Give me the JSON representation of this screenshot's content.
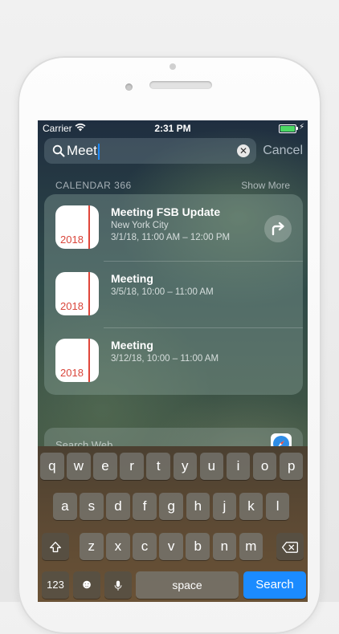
{
  "status_bar": {
    "carrier": "Carrier",
    "time": "2:31 PM",
    "battery_level": 1.0,
    "battery_color": "#4cd964",
    "charging_icon": "bolt-icon",
    "charging_glyph": "⚡"
  },
  "search": {
    "query": "Meet",
    "clear_glyph": "✕",
    "cancel_label": "Cancel"
  },
  "section": {
    "header": "CALENDAR 366",
    "show_more": "Show More"
  },
  "results": [
    {
      "title": "Meeting FSB Update",
      "location": "New York City",
      "datetime": "3/1/18, 11:00 AM – 12:00 PM",
      "icon_year": "2018"
    },
    {
      "title": "Meeting",
      "datetime": "3/5/18, 10:00 – 11:00 AM",
      "icon_year": "2018"
    },
    {
      "title": "Meeting",
      "datetime": "3/12/18, 10:00 – 11:00 AM",
      "icon_year": "2018"
    }
  ],
  "search_web": {
    "label": "Search Web"
  },
  "keyboard": {
    "row1": [
      "q",
      "w",
      "e",
      "r",
      "t",
      "y",
      "u",
      "i",
      "o",
      "p"
    ],
    "row2": [
      "a",
      "s",
      "d",
      "f",
      "g",
      "h",
      "j",
      "k",
      "l"
    ],
    "row3": [
      "z",
      "x",
      "c",
      "v",
      "b",
      "n",
      "m"
    ],
    "numbers_label": "123",
    "emoji_glyph": "☻",
    "space_label": "space",
    "search_label": "Search",
    "accent_color": "#1b8bff"
  }
}
